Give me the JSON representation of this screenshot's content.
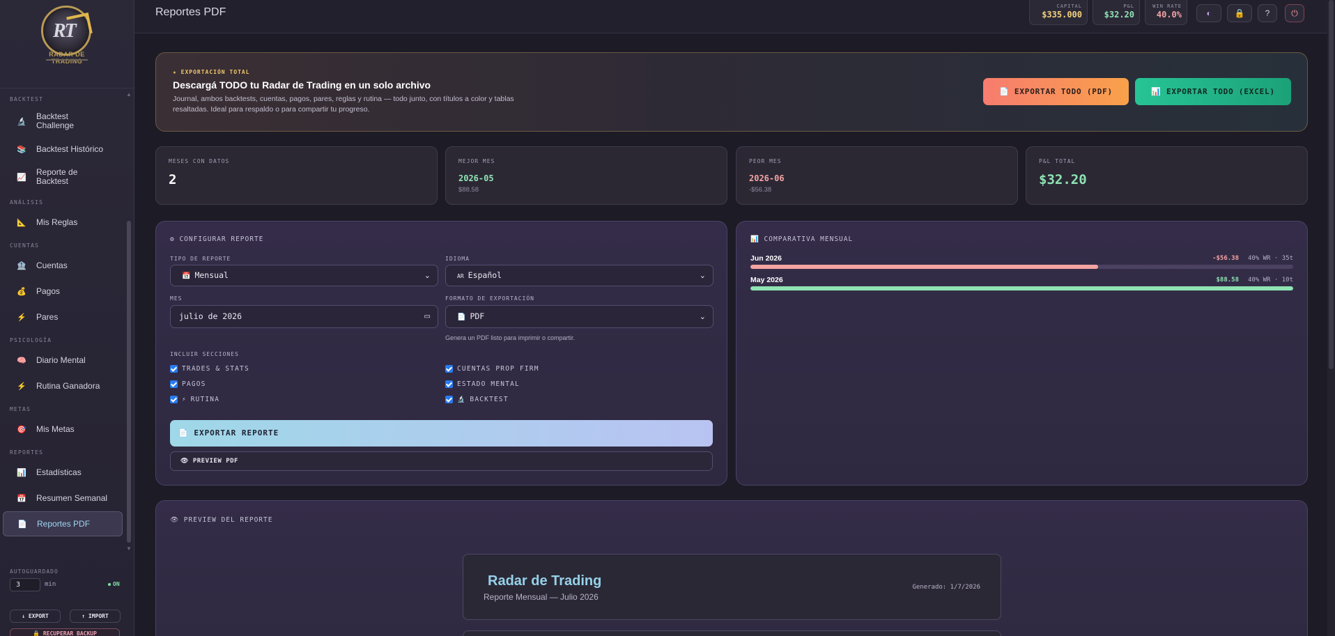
{
  "app": {
    "logo_text": "RADAR DE TRADING",
    "logo_letters": "RT"
  },
  "sidebar": {
    "groups": [
      {
        "title": "BACKTEST",
        "items": [
          {
            "label": "Backtest Challenge",
            "icon": "microscope-icon",
            "glyph": "🔬"
          },
          {
            "label": "Backtest Histórico",
            "icon": "books-icon",
            "glyph": "📚"
          },
          {
            "label": "Reporte de Backtest",
            "icon": "chart-up-icon",
            "glyph": "📈"
          }
        ]
      },
      {
        "title": "ANÁLISIS",
        "items": [
          {
            "label": "Mis Reglas",
            "icon": "ruler-icon",
            "glyph": "📐"
          }
        ]
      },
      {
        "title": "CUENTAS",
        "items": [
          {
            "label": "Cuentas",
            "icon": "bank-icon",
            "glyph": "🏦"
          },
          {
            "label": "Pagos",
            "icon": "money-bag-icon",
            "glyph": "💰"
          },
          {
            "label": "Pares",
            "icon": "lightning-icon",
            "glyph": "⚡"
          }
        ]
      },
      {
        "title": "PSICOLOGÍA",
        "items": [
          {
            "label": "Diario Mental",
            "icon": "brain-icon",
            "glyph": "🧠"
          },
          {
            "label": "Rutina Ganadora",
            "icon": "lightning-icon",
            "glyph": "⚡"
          }
        ]
      },
      {
        "title": "METAS",
        "items": [
          {
            "label": "Mis Metas",
            "icon": "target-icon",
            "glyph": "🎯"
          }
        ]
      },
      {
        "title": "REPORTES",
        "items": [
          {
            "label": "Estadísticas",
            "icon": "bar-chart-icon",
            "glyph": "📊"
          },
          {
            "label": "Resumen Semanal",
            "icon": "calendar-icon",
            "glyph": "📅"
          },
          {
            "label": "Reportes PDF",
            "icon": "document-icon",
            "glyph": "📄",
            "active": true
          }
        ]
      }
    ],
    "autosave": {
      "title": "AUTOGUARDADO",
      "value": "3",
      "unit": "min",
      "status": "ON"
    },
    "export_label": "↓ EXPORT",
    "import_label": "↑ IMPORT",
    "recover_label": "🔒 RECUPERAR BACKUP"
  },
  "header": {
    "title": "Reportes PDF",
    "metrics": [
      {
        "label": "CAPITAL",
        "value": "$335.000",
        "color": "#f2d27a"
      },
      {
        "label": "P&L",
        "value": "$32.20",
        "color": "#8fe3b3"
      },
      {
        "label": "WIN RATE",
        "value": "40.0%",
        "color": "#f4a3a3"
      }
    ],
    "buttons": [
      {
        "name": "theme-toggle-icon",
        "glyph": "◐"
      },
      {
        "name": "lock-icon",
        "glyph": "🔒"
      },
      {
        "name": "help-icon",
        "glyph": "?"
      },
      {
        "name": "power-icon",
        "glyph": "⏻"
      }
    ]
  },
  "banner": {
    "kicker": "★ EXPORTACIÓN TOTAL",
    "title": "Descargá TODO tu Radar de Trading en un solo archivo",
    "description": "Journal, ambos backtests, cuentas, pagos, pares, reglas y rutina — todo junto, con títulos a color y tablas resaltadas. Ideal para respaldo o para compartir tu progreso.",
    "pdf_button": "📄  EXPORTAR TODO (PDF)",
    "excel_button": "📊  EXPORTAR TODO (EXCEL)"
  },
  "stats": [
    {
      "label": "MESES CON DATOS",
      "value": "2",
      "sub": ""
    },
    {
      "label": "MEJOR MES",
      "value": "2026-05",
      "sub": "$88.58",
      "color": "#8fe3b3"
    },
    {
      "label": "PEOR MES",
      "value": "2026-06",
      "sub": "-$56.38",
      "color": "#f4a3a3"
    },
    {
      "label": "P&L TOTAL",
      "value": "$32.20",
      "sub": "",
      "color": "#8fe3b3"
    }
  ],
  "config": {
    "title": "⚙ CONFIGURAR REPORTE",
    "type_label": "TIPO DE REPORTE",
    "type_value": "Mensual",
    "language_label": "IDIOMA",
    "language_value": "Español",
    "language_prefix": "AR",
    "month_label": "MES",
    "month_value": "julio de 2026",
    "format_label": "FORMATO DE EXPORTACIÓN",
    "format_value": "PDF",
    "format_hint": "Genera un PDF listo para imprimir o compartir.",
    "sections_label": "INCLUIR SECCIONES",
    "sections": [
      {
        "label": "TRADES & STATS",
        "emoji": ""
      },
      {
        "label": "CUENTAS PROP FIRM",
        "emoji": ""
      },
      {
        "label": "PAGOS",
        "emoji": ""
      },
      {
        "label": "ESTADO MENTAL",
        "emoji": ""
      },
      {
        "label": "RUTINA",
        "emoji": "⚡"
      },
      {
        "label": "BACKTEST",
        "emoji": "🔬"
      }
    ],
    "export_button": "📄  EXPORTAR REPORTE",
    "preview_button": "👁 PREVIEW PDF"
  },
  "comparison": {
    "title": "📊 COMPARATIVA MENSUAL",
    "months": [
      {
        "name": "Jun 2026",
        "pnl": "-$56.38",
        "meta": "40% WR · 35t",
        "fill": 0.64,
        "color": "#f4a3a3"
      },
      {
        "name": "May 2026",
        "pnl": "$88.58",
        "meta": "40% WR · 10t",
        "fill": 1.0,
        "color": "#8fe3b3"
      }
    ]
  },
  "preview": {
    "title": "👁 PREVIEW DEL REPORTE",
    "doc_title": "Radar de Trading",
    "doc_subtitle": "Reporte Mensual — Julio 2026",
    "doc_date": "Generado: 1/7/2026"
  }
}
